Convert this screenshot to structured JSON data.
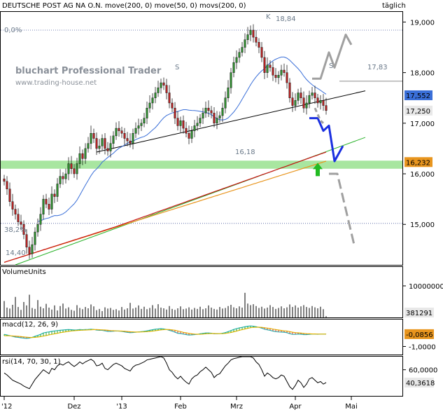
{
  "header": {
    "title": "DEUTSCHE POST AG NA O.N. move(200, 0) move(50, 0) movs(200, 0)",
    "period": "täglich"
  },
  "watermark": {
    "line1": "bluchart Professional Trader",
    "line2": "www.trading-house.net"
  },
  "colors": {
    "candle_up": "#2e8b2e",
    "candle_down": "#b22222",
    "ma200": "#e8951e",
    "ma50": "#3a6fd8",
    "movs200": "#c81414",
    "trend_green": "#2bb32b",
    "support_band": "#a8e6a0",
    "forecast_blue": "#1a2fe0",
    "forecast_gray": "#a0a0a0",
    "arrow_green": "#22bb22"
  },
  "chart_data": [
    {
      "panel": "price",
      "type": "candlestick",
      "title": "DEUTSCHE POST AG NA O.N.",
      "ylim": [
        14.2,
        19.2
      ],
      "y_ticks": [
        "19,000",
        "18,000",
        "17,000",
        "16,000",
        "15,000"
      ],
      "y_tick_values": [
        19,
        18,
        17,
        16,
        15
      ],
      "x_ticks": [
        "'12",
        "Dez",
        "'13",
        "Feb",
        "Mrz",
        "Apr",
        "Mai"
      ],
      "x_tick_index": [
        0,
        25,
        42,
        63,
        83,
        104,
        124
      ],
      "close": [
        15.85,
        15.7,
        15.45,
        15.3,
        15.2,
        15.05,
        15.0,
        14.8,
        14.55,
        14.42,
        14.6,
        14.85,
        15.0,
        15.2,
        15.5,
        15.4,
        15.3,
        15.6,
        15.55,
        15.8,
        15.95,
        15.9,
        16.0,
        16.2,
        16.1,
        16.0,
        16.2,
        16.4,
        16.3,
        16.5,
        16.6,
        16.8,
        16.7,
        16.5,
        16.55,
        16.7,
        16.5,
        16.45,
        16.6,
        16.75,
        16.9,
        16.85,
        16.8,
        16.7,
        16.65,
        16.6,
        16.8,
        16.9,
        16.95,
        17.0,
        17.1,
        17.3,
        17.4,
        17.5,
        17.6,
        17.7,
        17.8,
        17.75,
        17.6,
        17.4,
        17.3,
        17.1,
        16.95,
        17.05,
        16.9,
        16.8,
        16.7,
        16.85,
        16.95,
        17.0,
        17.1,
        17.2,
        17.3,
        17.25,
        17.2,
        17.0,
        17.1,
        17.15,
        17.3,
        17.5,
        17.7,
        18.0,
        18.2,
        18.3,
        18.4,
        18.5,
        18.65,
        18.75,
        18.84,
        18.7,
        18.6,
        18.5,
        18.3,
        18.0,
        18.15,
        18.1,
        17.95,
        17.9,
        17.95,
        18.05,
        18.0,
        17.8,
        17.5,
        17.35,
        17.45,
        17.6,
        17.5,
        17.3,
        17.4,
        17.55,
        17.6,
        17.5,
        17.4,
        17.45,
        17.35,
        17.25
      ],
      "annotations": [
        {
          "text": "18,84",
          "value": 18.84
        },
        {
          "text": "K"
        },
        {
          "text": "S"
        },
        {
          "text": "S"
        },
        {
          "text": "16,18",
          "value": 16.18
        },
        {
          "text": "17,83",
          "value": 17.83
        },
        {
          "text": "14,40",
          "value": 14.4
        },
        {
          "text": "0,0%"
        },
        {
          "text": "38,2%"
        }
      ],
      "support_band": [
        16.1,
        16.26
      ],
      "fib_levels": [
        18.84,
        15.02
      ],
      "resistance_level": 17.83,
      "last_value_labels": [
        {
          "text": "17,552",
          "value": 17.552,
          "color": "#3a6fd8"
        },
        {
          "text": "17,250",
          "value": 17.25,
          "color": "#e8e8e8"
        },
        {
          "text": "16,232",
          "value": 16.232,
          "color": "#e8951e"
        }
      ],
      "trendlines": [
        {
          "name": "support",
          "from": [
            33,
            16.43
          ],
          "to": [
            129,
            17.64
          ]
        },
        {
          "name": "green-trend",
          "from": [
            4,
            14.2
          ],
          "to": [
            129,
            16.72
          ]
        }
      ],
      "forecast_paths": [
        {
          "color": "blue",
          "points": [
            [
              109,
              17.1
            ],
            [
              112,
              17.1
            ],
            [
              114,
              16.85
            ],
            [
              116,
              16.95
            ],
            [
              118,
              16.25
            ],
            [
              121,
              16.55
            ]
          ]
        },
        {
          "color": "gray-up",
          "points": [
            [
              110,
              17.88
            ],
            [
              113,
              17.88
            ],
            [
              116,
              18.4
            ],
            [
              118,
              18.1
            ],
            [
              122,
              18.75
            ],
            [
              124,
              18.55
            ]
          ]
        },
        {
          "color": "gray-down",
          "points": [
            [
              111,
              17.3
            ],
            [
              113,
              17.05
            ],
            [
              114,
              17.0
            ]
          ]
        },
        {
          "color": "gray-low",
          "points": [
            [
              116,
              16.0
            ],
            [
              119,
              16.0
            ],
            [
              125,
              14.6
            ]
          ]
        }
      ]
    },
    {
      "panel": "volume",
      "type": "bar",
      "title": "VolumeUnits",
      "y_ticks": [
        "10000000"
      ],
      "y_tick_values": [
        10000000
      ],
      "last_value_label": "381291",
      "ylim": [
        0,
        16000000
      ],
      "values": [
        5.2,
        3.1,
        2.8,
        4.0,
        6.5,
        3.3,
        2.4,
        4.9,
        3.8,
        7.2,
        3.0,
        2.7,
        5.5,
        3.4,
        2.9,
        4.3,
        3.1,
        2.5,
        3.8,
        2.2,
        3.6,
        4.4,
        2.8,
        3.2,
        2.4,
        2.1,
        3.9,
        3.0,
        2.6,
        3.3,
        2.9,
        4.1,
        3.5,
        2.3,
        2.7,
        2.0,
        3.2,
        2.8,
        3.0,
        2.4,
        2.6,
        2.2,
        3.3,
        2.5,
        2.9,
        4.6,
        2.8,
        3.1,
        3.8,
        2.7,
        3.4,
        2.6,
        3.0,
        3.9,
        2.8,
        4.2,
        3.1,
        2.9,
        2.5,
        3.6,
        2.7,
        2.4,
        2.9,
        3.5,
        2.6,
        2.8,
        3.2,
        2.5,
        3.0,
        2.7,
        3.4,
        2.6,
        2.9,
        3.8,
        3.1,
        2.7,
        2.5,
        3.3,
        2.8,
        3.0,
        3.6,
        4.0,
        3.2,
        2.9,
        3.5,
        3.1,
        7.8,
        4.4,
        3.9,
        4.2,
        3.6,
        3.0,
        3.4,
        2.8,
        3.1,
        3.9,
        3.3,
        2.7,
        3.0,
        3.5,
        2.9,
        3.2,
        4.1,
        3.3,
        3.8,
        3.1,
        3.5,
        3.9,
        3.3,
        3.0,
        3.6,
        3.2,
        2.9,
        3.4,
        2.6,
        0.4
      ]
    },
    {
      "panel": "macd",
      "type": "line",
      "title": "macd(12, 26, 9)",
      "y_ticks": [
        "-1,0000"
      ],
      "y_tick_values": [
        -1
      ],
      "last_value_label": "-0,0856",
      "ylim": [
        -1.6,
        1.0
      ],
      "series": [
        {
          "values": [
            -0.1,
            -0.15,
            -0.2,
            -0.25,
            -0.3,
            -0.32,
            -0.35,
            -0.38,
            -0.4,
            -0.38,
            -0.32,
            -0.25,
            -0.18,
            -0.1,
            0.0,
            0.05,
            0.08,
            0.12,
            0.15,
            0.18,
            0.2,
            0.22,
            0.24,
            0.25,
            0.24,
            0.22,
            0.23,
            0.25,
            0.24,
            0.25,
            0.26,
            0.28,
            0.26,
            0.22,
            0.2,
            0.2,
            0.16,
            0.12,
            0.12,
            0.13,
            0.15,
            0.14,
            0.12,
            0.08,
            0.05,
            0.02,
            0.04,
            0.06,
            0.08,
            0.1,
            0.12,
            0.16,
            0.2,
            0.24,
            0.28,
            0.3,
            0.32,
            0.3,
            0.26,
            0.2,
            0.14,
            0.06,
            -0.02,
            -0.04,
            -0.08,
            -0.12,
            -0.15,
            -0.14,
            -0.12,
            -0.1,
            -0.06,
            -0.03,
            0.0,
            0.0,
            -0.02,
            -0.06,
            -0.06,
            -0.05,
            -0.02,
            0.03,
            0.1,
            0.18,
            0.26,
            0.32,
            0.38,
            0.42,
            0.46,
            0.5,
            0.52,
            0.5,
            0.46,
            0.42,
            0.36,
            0.28,
            0.24,
            0.2,
            0.14,
            0.1,
            0.08,
            0.07,
            0.06,
            0.02,
            -0.05,
            -0.1,
            -0.1,
            -0.08,
            -0.09,
            -0.12,
            -0.12,
            -0.1,
            -0.08,
            -0.08,
            -0.09,
            -0.08,
            -0.08,
            -0.0856
          ]
        },
        {
          "values": [
            -0.2,
            -0.2,
            -0.21,
            -0.22,
            -0.23,
            -0.25,
            -0.27,
            -0.29,
            -0.31,
            -0.33,
            -0.33,
            -0.32,
            -0.3,
            -0.27,
            -0.23,
            -0.19,
            -0.14,
            -0.1,
            -0.06,
            -0.02,
            0.02,
            0.06,
            0.09,
            0.12,
            0.15,
            0.17,
            0.19,
            0.2,
            0.21,
            0.22,
            0.23,
            0.24,
            0.25,
            0.25,
            0.24,
            0.23,
            0.22,
            0.2,
            0.18,
            0.17,
            0.16,
            0.15,
            0.14,
            0.13,
            0.11,
            0.09,
            0.08,
            0.07,
            0.07,
            0.08,
            0.09,
            0.1,
            0.12,
            0.14,
            0.17,
            0.2,
            0.23,
            0.25,
            0.26,
            0.25,
            0.23,
            0.2,
            0.15,
            0.1,
            0.05,
            0.01,
            -0.03,
            -0.06,
            -0.08,
            -0.09,
            -0.09,
            -0.08,
            -0.06,
            -0.05,
            -0.04,
            -0.04,
            -0.05,
            -0.05,
            -0.05,
            -0.03,
            0.0,
            0.04,
            0.09,
            0.14,
            0.2,
            0.25,
            0.3,
            0.35,
            0.39,
            0.42,
            0.43,
            0.43,
            0.42,
            0.39,
            0.36,
            0.33,
            0.29,
            0.25,
            0.22,
            0.19,
            0.16,
            0.14,
            0.1,
            0.06,
            0.03,
            0.01,
            -0.01,
            -0.03,
            -0.05,
            -0.06,
            -0.07,
            -0.07,
            -0.08,
            -0.08,
            -0.08,
            -0.08
          ]
        }
      ]
    },
    {
      "panel": "rsi",
      "type": "line",
      "title": "rsi(14, 70, 30, 1)",
      "y_ticks": [
        "60,0000"
      ],
      "y_tick_values": [
        60
      ],
      "last_value_label": "40,3618",
      "ylim": [
        20,
        80
      ],
      "series": [
        {
          "values": [
            55,
            52,
            48,
            44,
            42,
            40,
            38,
            35,
            33,
            31,
            38,
            45,
            50,
            55,
            60,
            57,
            54,
            62,
            60,
            66,
            69,
            67,
            70,
            72,
            68,
            65,
            68,
            72,
            69,
            72,
            74,
            76,
            73,
            66,
            67,
            70,
            62,
            60,
            64,
            68,
            70,
            68,
            66,
            62,
            60,
            58,
            64,
            67,
            68,
            70,
            72,
            75,
            76,
            77,
            78,
            79,
            80,
            78,
            70,
            60,
            56,
            50,
            46,
            50,
            45,
            41,
            38,
            46,
            50,
            52,
            57,
            60,
            64,
            60,
            56,
            48,
            52,
            54,
            60,
            66,
            70,
            75,
            77,
            78,
            79,
            80,
            82,
            83,
            84,
            78,
            72,
            68,
            60,
            50,
            55,
            52,
            48,
            46,
            48,
            52,
            50,
            42,
            34,
            30,
            36,
            44,
            40,
            33,
            38,
            46,
            48,
            44,
            40,
            42,
            38,
            40.36
          ]
        }
      ]
    }
  ]
}
